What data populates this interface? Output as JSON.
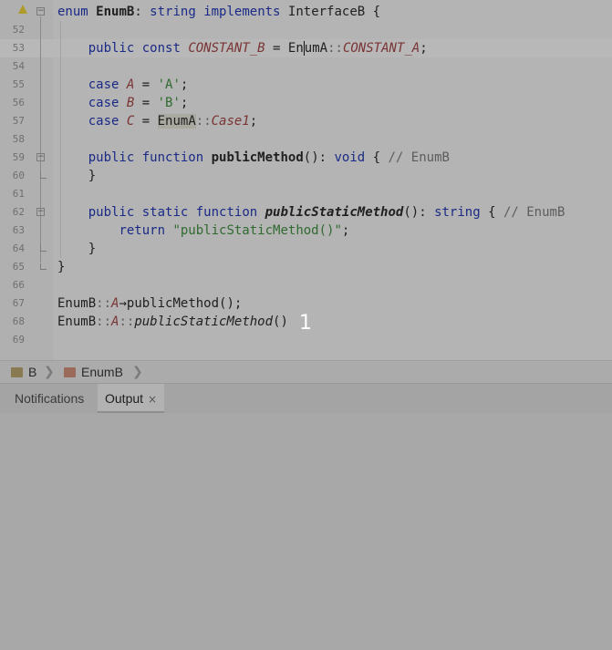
{
  "editor": {
    "lines": [
      {
        "num": "",
        "tokens": [
          {
            "t": "enum",
            "c": "kw"
          },
          {
            "t": " ",
            "c": ""
          },
          {
            "t": "EnumB",
            "c": "fn"
          },
          {
            "t": ": ",
            "c": ""
          },
          {
            "t": "string",
            "c": "kw"
          },
          {
            "t": " ",
            "c": ""
          },
          {
            "t": "implements",
            "c": "kw"
          },
          {
            "t": " InterfaceB {",
            "c": ""
          }
        ]
      },
      {
        "num": "52",
        "tokens": []
      },
      {
        "num": "53",
        "tokens": [
          {
            "t": "    ",
            "c": ""
          },
          {
            "t": "public",
            "c": "kw"
          },
          {
            "t": " ",
            "c": ""
          },
          {
            "t": "const",
            "c": "kw"
          },
          {
            "t": " ",
            "c": ""
          },
          {
            "t": "CONSTANT_B",
            "c": "cst"
          },
          {
            "t": " = ",
            "c": ""
          },
          {
            "t": "En",
            "c": ""
          },
          {
            "t": "|",
            "c": "caret"
          },
          {
            "t": "umA",
            "c": ""
          },
          {
            "t": "::",
            "c": "op"
          },
          {
            "t": "CONSTANT_A",
            "c": "cst"
          },
          {
            "t": ";",
            "c": ""
          }
        ]
      },
      {
        "num": "54",
        "tokens": []
      },
      {
        "num": "55",
        "tokens": [
          {
            "t": "    ",
            "c": ""
          },
          {
            "t": "case",
            "c": "kw"
          },
          {
            "t": " ",
            "c": ""
          },
          {
            "t": "A",
            "c": "cst"
          },
          {
            "t": " = ",
            "c": ""
          },
          {
            "t": "'A'",
            "c": "str"
          },
          {
            "t": ";",
            "c": ""
          }
        ]
      },
      {
        "num": "56",
        "tokens": [
          {
            "t": "    ",
            "c": ""
          },
          {
            "t": "case",
            "c": "kw"
          },
          {
            "t": " ",
            "c": ""
          },
          {
            "t": "B",
            "c": "cst"
          },
          {
            "t": " = ",
            "c": ""
          },
          {
            "t": "'B'",
            "c": "str"
          },
          {
            "t": ";",
            "c": ""
          }
        ]
      },
      {
        "num": "57",
        "tokens": [
          {
            "t": "    ",
            "c": ""
          },
          {
            "t": "case",
            "c": "kw"
          },
          {
            "t": " ",
            "c": ""
          },
          {
            "t": "C",
            "c": "cst"
          },
          {
            "t": " = ",
            "c": ""
          },
          {
            "t": "EnumA",
            "c": "cls-hl"
          },
          {
            "t": "::",
            "c": "op"
          },
          {
            "t": "Case1",
            "c": "cst"
          },
          {
            "t": ";",
            "c": ""
          }
        ]
      },
      {
        "num": "58",
        "tokens": []
      },
      {
        "num": "59",
        "tokens": [
          {
            "t": "    ",
            "c": ""
          },
          {
            "t": "public",
            "c": "kw"
          },
          {
            "t": " ",
            "c": ""
          },
          {
            "t": "function",
            "c": "kw"
          },
          {
            "t": " ",
            "c": ""
          },
          {
            "t": "publicMethod",
            "c": "fn"
          },
          {
            "t": "(): ",
            "c": ""
          },
          {
            "t": "void",
            "c": "kw"
          },
          {
            "t": " { ",
            "c": ""
          },
          {
            "t": "// EnumB",
            "c": "cmt"
          }
        ]
      },
      {
        "num": "60",
        "tokens": [
          {
            "t": "    }",
            "c": ""
          }
        ]
      },
      {
        "num": "61",
        "tokens": []
      },
      {
        "num": "62",
        "tokens": [
          {
            "t": "    ",
            "c": ""
          },
          {
            "t": "public",
            "c": "kw"
          },
          {
            "t": " ",
            "c": ""
          },
          {
            "t": "static",
            "c": "kw"
          },
          {
            "t": " ",
            "c": ""
          },
          {
            "t": "function",
            "c": "kw"
          },
          {
            "t": " ",
            "c": ""
          },
          {
            "t": "publicStaticMethod",
            "c": "fni"
          },
          {
            "t": "(): ",
            "c": ""
          },
          {
            "t": "string",
            "c": "kw"
          },
          {
            "t": " { ",
            "c": ""
          },
          {
            "t": "// EnumB",
            "c": "cmt"
          }
        ]
      },
      {
        "num": "63",
        "tokens": [
          {
            "t": "        ",
            "c": ""
          },
          {
            "t": "return",
            "c": "kw"
          },
          {
            "t": " ",
            "c": ""
          },
          {
            "t": "\"publicStaticMethod()\"",
            "c": "str"
          },
          {
            "t": ";",
            "c": ""
          }
        ]
      },
      {
        "num": "64",
        "tokens": [
          {
            "t": "    }",
            "c": ""
          }
        ]
      },
      {
        "num": "65",
        "tokens": [
          {
            "t": "}",
            "c": ""
          }
        ]
      },
      {
        "num": "66",
        "tokens": []
      },
      {
        "num": "67",
        "tokens": [
          {
            "t": "EnumB",
            "c": ""
          },
          {
            "t": "::",
            "c": "op"
          },
          {
            "t": "A",
            "c": "cst"
          },
          {
            "t": "→",
            "c": ""
          },
          {
            "t": "publicMethod();",
            "c": ""
          }
        ]
      },
      {
        "num": "68",
        "tokens": [
          {
            "t": "EnumB",
            "c": ""
          },
          {
            "t": "::",
            "c": "op"
          },
          {
            "t": "A",
            "c": "cst"
          },
          {
            "t": "::",
            "c": "op"
          },
          {
            "t": "publicStaticMethod",
            "c": "ital"
          },
          {
            "t": "()",
            "c": ""
          }
        ]
      },
      {
        "num": "69",
        "tokens": []
      }
    ],
    "overlay_mark": "1"
  },
  "breadcrumb": {
    "items": [
      {
        "label": "B",
        "icon": "namespace-icon"
      },
      {
        "label": "EnumB",
        "icon": "enum-icon"
      }
    ]
  },
  "toolwindow": {
    "tabs": [
      {
        "label": "Notifications",
        "active": false
      },
      {
        "label": "Output",
        "active": true,
        "closable": true,
        "close_glyph": "×"
      }
    ]
  },
  "colors": {
    "keyword": "#1a2a86",
    "constant": "#7a3434",
    "string": "#2f6a2f",
    "comment": "#5c5c5c"
  }
}
